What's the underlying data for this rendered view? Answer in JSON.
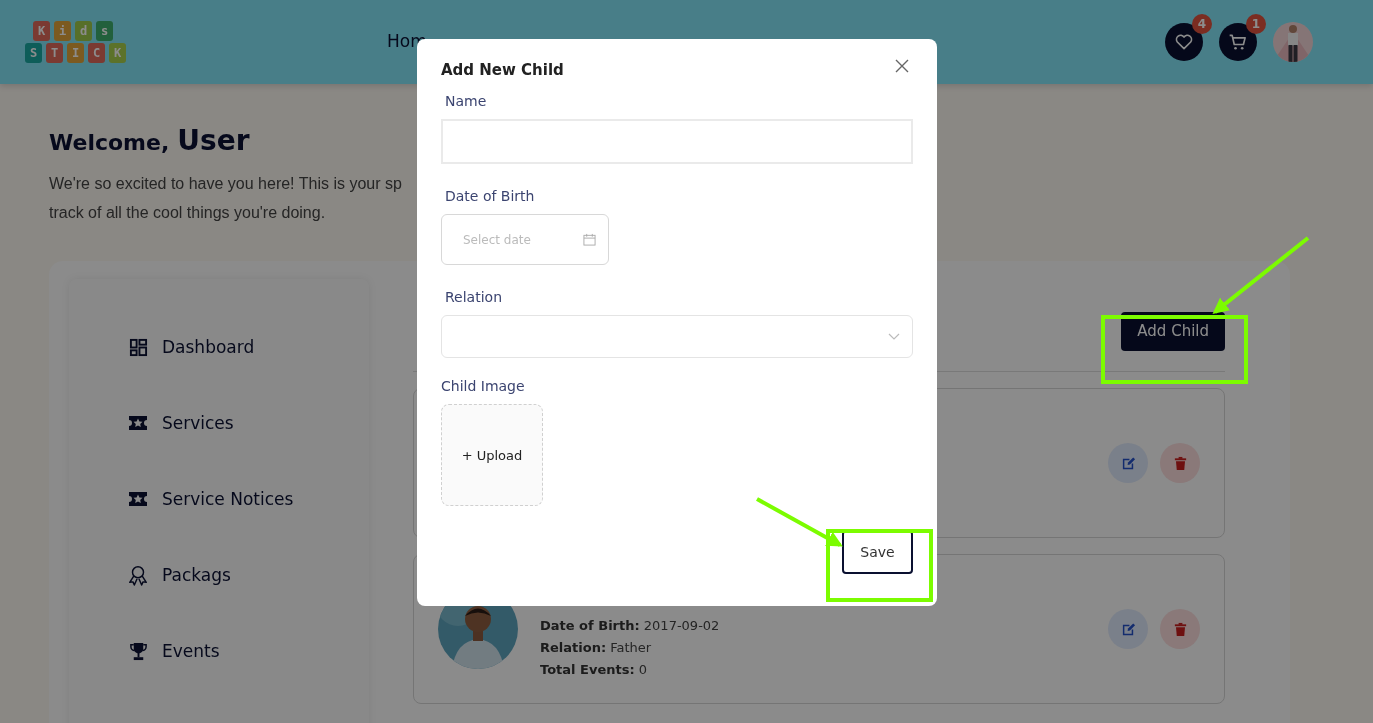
{
  "header": {
    "logo": {
      "rows": [
        [
          "K",
          "i",
          "d",
          "s"
        ],
        [
          "S",
          "T",
          "I",
          "C",
          "K"
        ]
      ]
    },
    "nav": [
      {
        "label": "Hom"
      }
    ],
    "wishlist": {
      "badge": "4"
    },
    "cart": {
      "badge": "1"
    }
  },
  "welcome": {
    "greeting": "Welcome,",
    "name": "User",
    "lines": [
      "We're so excited to have you here! This is your sp",
      "track of all the cool things you're doing."
    ]
  },
  "sidebar": {
    "items": [
      {
        "label": "Dashboard",
        "kind": "dashboard"
      },
      {
        "label": "Services",
        "kind": "ticket"
      },
      {
        "label": "Service Notices",
        "kind": "ticket"
      },
      {
        "label": "Packags",
        "kind": "award"
      },
      {
        "label": "Events",
        "kind": "trophy"
      }
    ]
  },
  "children_panel": {
    "add_button": "Add Child",
    "cards": [
      {
        "photo": false
      },
      {
        "photo": true,
        "fields": [
          {
            "label": "Date of Birth:",
            "value": "2017-09-02"
          },
          {
            "label": "Relation:",
            "value": "Father"
          },
          {
            "label": "Total Events:",
            "value": "0"
          }
        ]
      }
    ]
  },
  "modal": {
    "title": "Add New Child",
    "fields": [
      {
        "kind": "text",
        "label": "Name"
      },
      {
        "kind": "date",
        "label": "Date of Birth",
        "placeholder": "Select date"
      },
      {
        "kind": "select",
        "label": "Relation"
      },
      {
        "kind": "upload",
        "label": "Child Image",
        "button": "+ Upload"
      }
    ],
    "save": "Save"
  }
}
